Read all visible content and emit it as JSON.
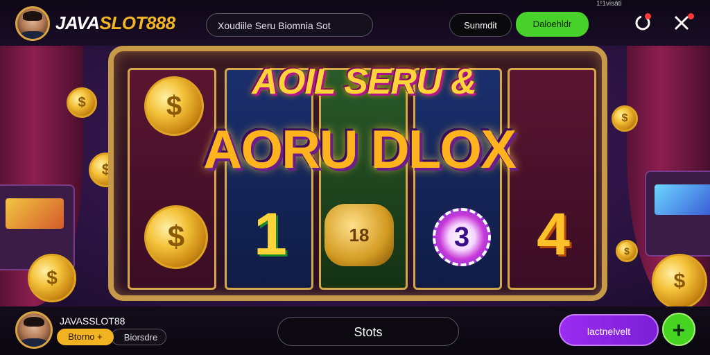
{
  "header": {
    "logo_part1": "JAVA",
    "logo_part2": "SLOT888",
    "search_text": "Xoudiile Seru Biomnia Sot",
    "btn_dark": "Sunmdit",
    "btn_green": "Daloehldr",
    "status_text": "1!1visāti"
  },
  "banner": {
    "line1": "AOIL SERU &",
    "line2": "AORU DLOX",
    "reel_symbols": [
      "$",
      "1",
      "18",
      "3",
      "4",
      "$"
    ]
  },
  "footer": {
    "username": "JAVASSLOT88",
    "pill1": "Btorno +",
    "pill2": "Biorsdre",
    "center_button": "Stots",
    "purple_button": "lactnelvelt",
    "plus_symbol": "+"
  },
  "colors": {
    "accent_gold": "#f3b622",
    "accent_green": "#48d12a",
    "accent_purple": "#9a2cf0"
  }
}
